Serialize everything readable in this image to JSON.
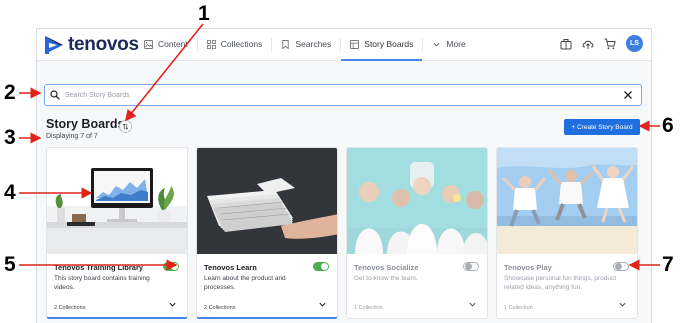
{
  "header": {
    "logo_text": "tenovos",
    "nav": [
      {
        "label": "Content",
        "icon": "image-icon"
      },
      {
        "label": "Collections",
        "icon": "grid-icon"
      },
      {
        "label": "Searches",
        "icon": "bookmark-icon"
      },
      {
        "label": "Story Boards",
        "icon": "storyboard-icon",
        "active": true
      },
      {
        "label": "More",
        "icon": "chevron-down-icon"
      }
    ],
    "right_icons": [
      "briefcase-icon",
      "upload-cloud-icon",
      "cart-icon"
    ],
    "avatar_initials": "LS"
  },
  "search": {
    "placeholder": "Search Story Boards",
    "value": ""
  },
  "page": {
    "title": "Story Boards",
    "count_text": "Displaying 7 of 7",
    "create_label": "+ Create Story Board"
  },
  "cards": [
    {
      "title": "Tenovos Training Library",
      "description": "This story board contains training videos.",
      "footer": "2 Collections",
      "enabled": true
    },
    {
      "title": "Tenovos Learn",
      "description": "Learn about the product and processes.",
      "footer": "2 Collections",
      "enabled": true
    },
    {
      "title": "Tenovos Socialize",
      "description": "Get to know the team.",
      "footer": "1 Collection",
      "enabled": false
    },
    {
      "title": "Tenovos Play",
      "description": "Showcase personal fun things, product related ideas, anything fun.",
      "footer": "1 Collection",
      "enabled": false
    }
  ],
  "callouts": [
    "1",
    "2",
    "3",
    "4",
    "5",
    "6",
    "7"
  ],
  "colors": {
    "accent": "#1f6fde",
    "toggle_on": "#4caf50",
    "callout_arrow": "#e0231b",
    "logo_mark": "#2a66d9",
    "logo_text": "#1d2a5c"
  }
}
